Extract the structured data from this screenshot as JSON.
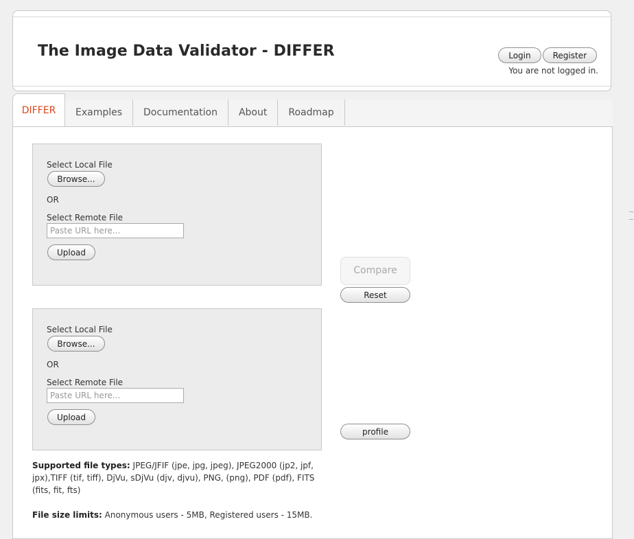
{
  "header": {
    "title": "The Image Data Validator - DIFFER",
    "login_label": "Login",
    "register_label": "Register",
    "login_status": "You are not logged in."
  },
  "tabs": [
    {
      "label": "DIFFER",
      "active": true
    },
    {
      "label": "Examples"
    },
    {
      "label": "Documentation"
    },
    {
      "label": "About"
    },
    {
      "label": "Roadmap"
    }
  ],
  "upload_panels": [
    {
      "local_label": "Select Local File",
      "browse_label": "Browse...",
      "or_label": "OR",
      "remote_label": "Select Remote File",
      "url_placeholder": "Paste URL here...",
      "upload_label": "Upload"
    },
    {
      "local_label": "Select Local File",
      "browse_label": "Browse...",
      "or_label": "OR",
      "remote_label": "Select Remote File",
      "url_placeholder": "Paste URL here...",
      "upload_label": "Upload"
    }
  ],
  "actions": {
    "compare_label": "Compare",
    "reset_label": "Reset",
    "profile_label": "profile"
  },
  "info": {
    "types_heading": "Supported file types:",
    "types_text": " JPEG/JFIF (jpe, jpg, jpeg), JPEG2000 (jp2, jpf, jpx),TIFF (tif, tiff), DjVu, sDjVu (djv, djvu), PNG, (png), PDF (pdf), FITS (fits, fit, fts)",
    "limits_heading": "File size limits:",
    "limits_text": " Anonymous users - 5MB, Registered users - 15MB."
  },
  "colors": {
    "active_tab": "#d9461c",
    "panel_bg": "#ececec"
  }
}
